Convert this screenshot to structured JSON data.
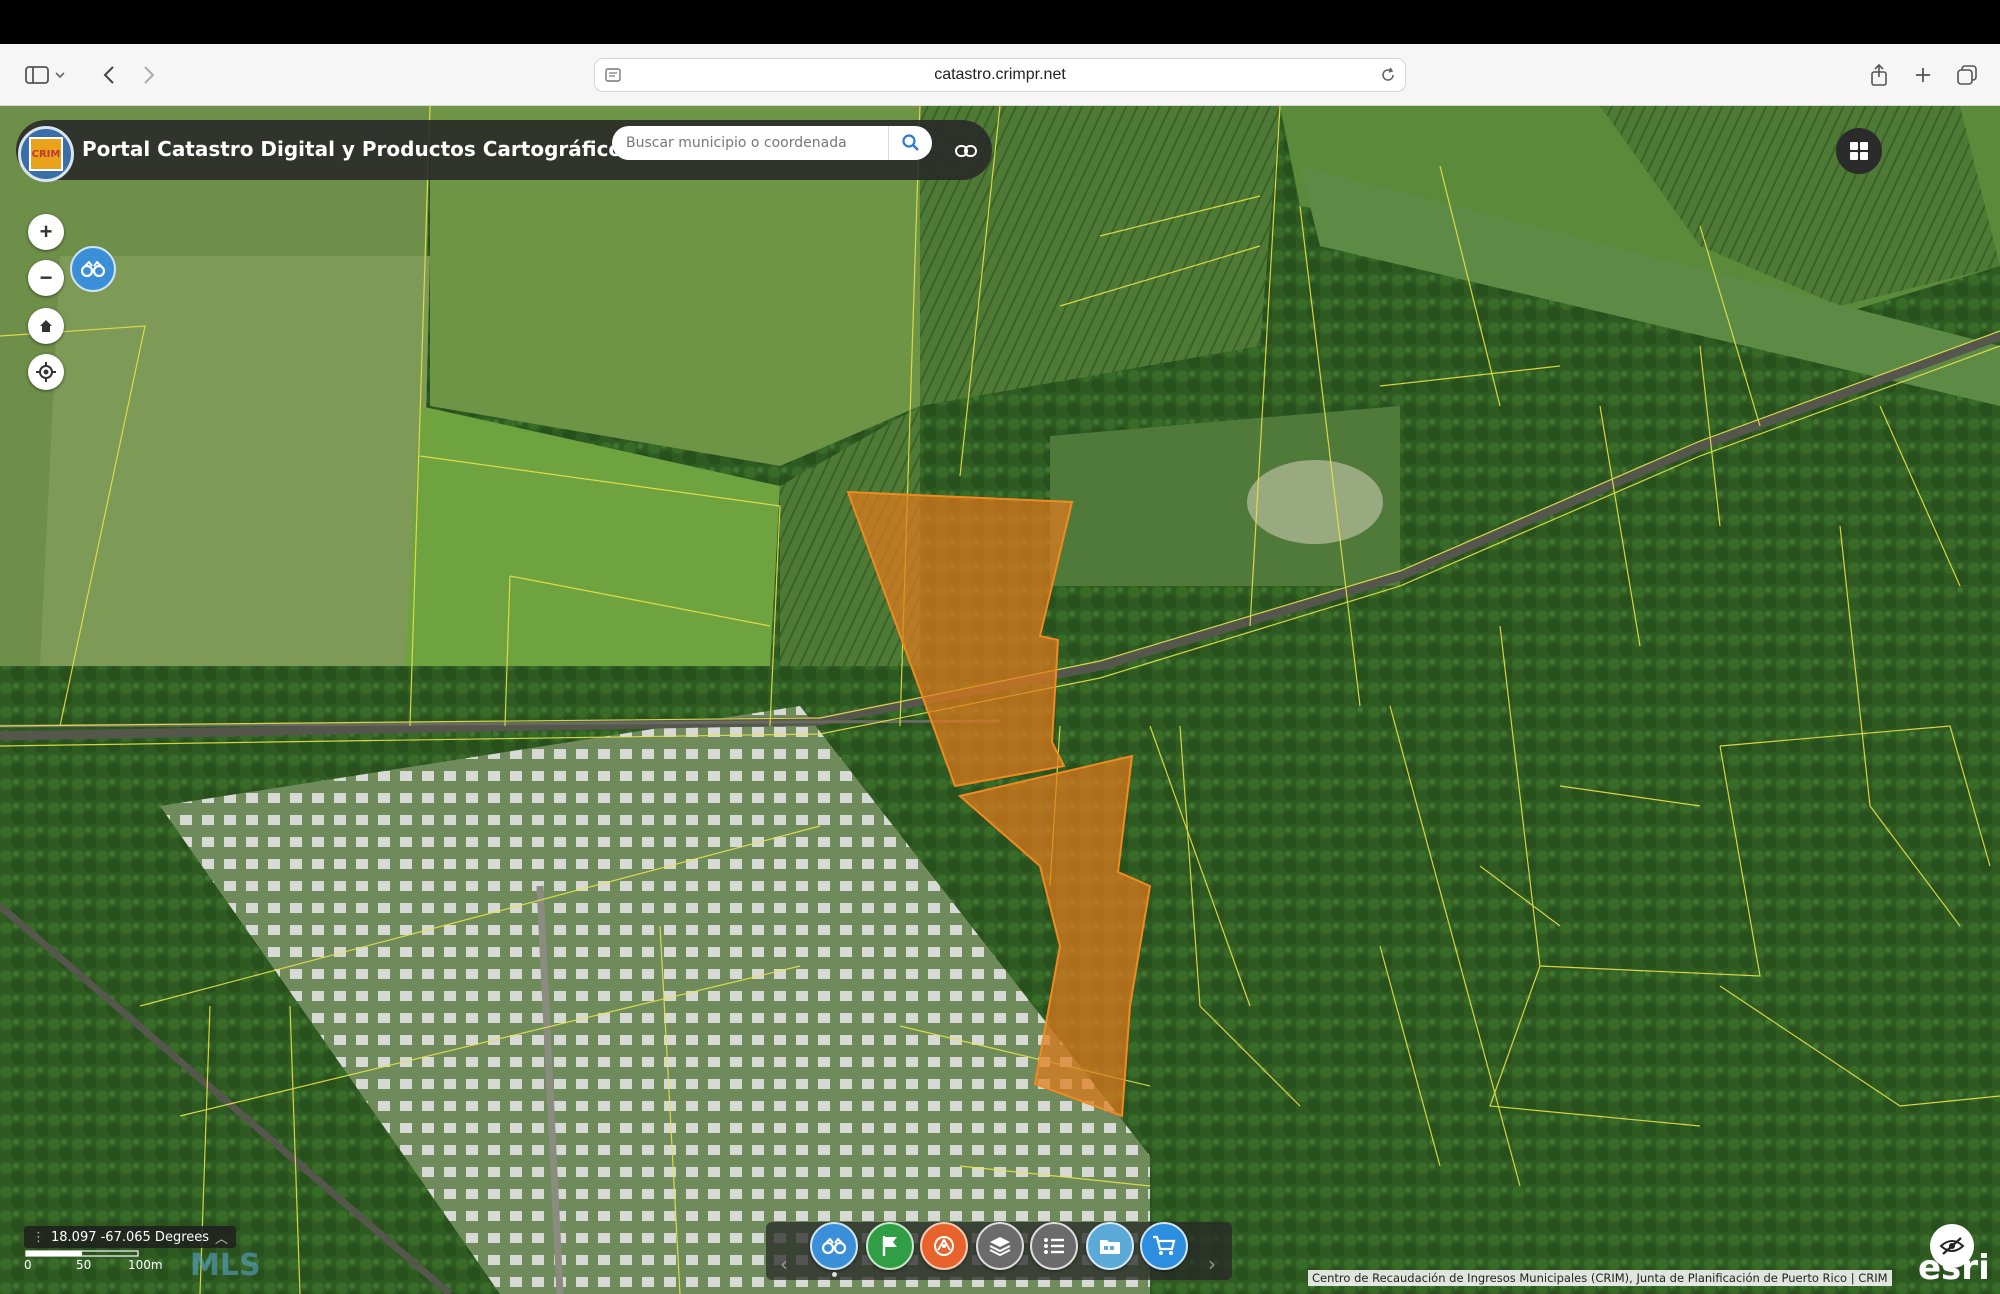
{
  "browser": {
    "url": "catastro.crimpr.net"
  },
  "app": {
    "title": "Portal Catastro Digital y Productos Cartográficos",
    "logo_text": "CRIM",
    "search_placeholder": "Buscar municipio o coordenada"
  },
  "map_controls": {
    "zoom_in": "+",
    "zoom_out": "−"
  },
  "status": {
    "coordinates": "18.097 -67.065 Degrees",
    "scale_labels": [
      "0",
      "50",
      "100m"
    ],
    "watermark": "MLS"
  },
  "toolbar": {
    "tools": [
      {
        "name": "binoculars-icon",
        "color": "#3b8fd8"
      },
      {
        "name": "flag-icon",
        "color": "#2f9e44"
      },
      {
        "name": "measure-icon",
        "color": "#e8632b"
      },
      {
        "name": "layers-icon",
        "color": "#6b6b6b"
      },
      {
        "name": "list-icon",
        "color": "#6b6b6b"
      },
      {
        "name": "folder-icon",
        "color": "#5aa9d6"
      },
      {
        "name": "cart-icon",
        "color": "#2d8ee0"
      }
    ],
    "prev": "‹",
    "next": "›"
  },
  "attribution": "Centro de Recaudación de Ingresos Municipales (CRIM), Junta de Planificación de Puerto Rico | CRIM",
  "esri_logo": "esri",
  "colors": {
    "parcel_highlight": "#e07a1c",
    "parcel_lines": "#e8e24a",
    "header_bg": "#282828",
    "accent_blue": "#3b8fd8"
  }
}
